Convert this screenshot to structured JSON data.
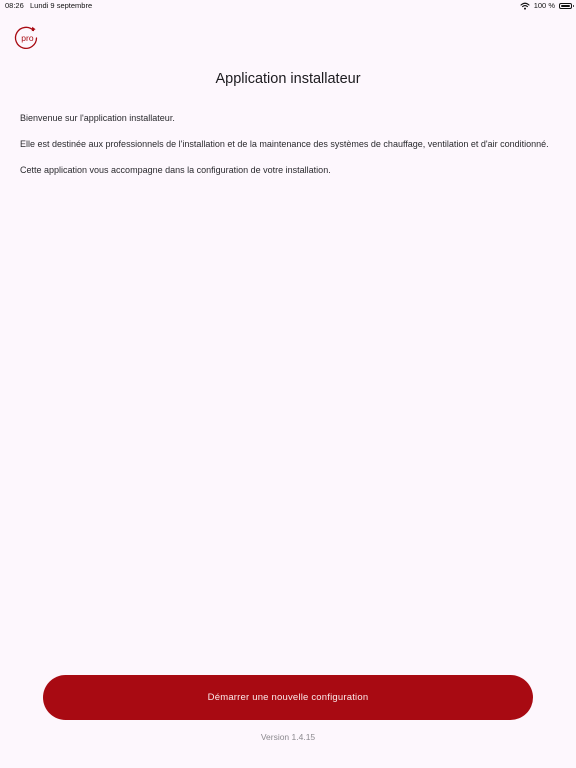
{
  "status_bar": {
    "time": "08:26",
    "date": "Lundi 9 septembre",
    "battery": "100 %",
    "wifi_icon": "wifi-icon",
    "battery_icon": "battery-icon"
  },
  "logo": {
    "text": "pro",
    "color": "#a80a12"
  },
  "page": {
    "title": "Application installateur",
    "paragraphs": [
      "Bienvenue sur l'application installateur.",
      "Elle est destinée aux professionnels de l'installation et de la maintenance des systèmes de chauffage, ventilation et d'air conditionné.",
      "Cette application vous accompagne dans la configuration de votre installation."
    ]
  },
  "actions": {
    "start_label": "Démarrer une nouvelle configuration"
  },
  "footer": {
    "version": "Version 1.4.15"
  },
  "colors": {
    "background": "#fdf7fd",
    "accent": "#a80a12"
  }
}
